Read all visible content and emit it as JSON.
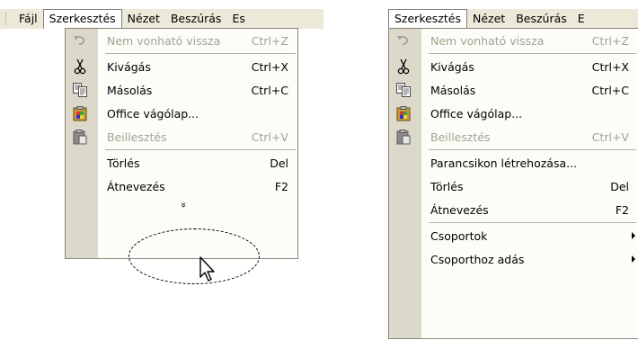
{
  "left": {
    "menubar": [
      "Fájl",
      "Szerkesztés",
      "Nézet",
      "Beszúrás",
      "Es"
    ],
    "open_index": 1,
    "items": [
      {
        "type": "item",
        "icon": "undo-icon",
        "label": "Nem vonható vissza",
        "shortcut": "Ctrl+Z",
        "disabled": true
      },
      {
        "type": "sep"
      },
      {
        "type": "item",
        "icon": "scissors-icon",
        "label": "Kivágás",
        "shortcut": "Ctrl+X",
        "disabled": false
      },
      {
        "type": "item",
        "icon": "copy-icon",
        "label": "Másolás",
        "shortcut": "Ctrl+C",
        "disabled": false
      },
      {
        "type": "item",
        "icon": "clipboard-office-icon",
        "label": "Office vágólap...",
        "shortcut": "",
        "disabled": false
      },
      {
        "type": "item",
        "icon": "paste-icon",
        "label": "Beillesztés",
        "shortcut": "Ctrl+V",
        "disabled": true
      },
      {
        "type": "sep"
      },
      {
        "type": "item",
        "icon": "",
        "label": "Törlés",
        "shortcut": "Del",
        "disabled": false
      },
      {
        "type": "item",
        "icon": "",
        "label": "Átnevezés",
        "shortcut": "F2",
        "disabled": false
      },
      {
        "type": "expand",
        "label": "»"
      }
    ]
  },
  "right": {
    "menubar": [
      "Szerkesztés",
      "Nézet",
      "Beszúrás",
      "E"
    ],
    "open_index": 0,
    "items": [
      {
        "type": "item",
        "icon": "undo-icon",
        "label": "Nem vonható vissza",
        "shortcut": "Ctrl+Z",
        "disabled": true
      },
      {
        "type": "sep"
      },
      {
        "type": "item",
        "icon": "scissors-icon",
        "label": "Kivágás",
        "shortcut": "Ctrl+X",
        "disabled": false
      },
      {
        "type": "item",
        "icon": "copy-icon",
        "label": "Másolás",
        "shortcut": "Ctrl+C",
        "disabled": false
      },
      {
        "type": "item",
        "icon": "clipboard-office-icon",
        "label": "Office vágólap...",
        "shortcut": "",
        "disabled": false
      },
      {
        "type": "item",
        "icon": "paste-icon",
        "label": "Beillesztés",
        "shortcut": "Ctrl+V",
        "disabled": true
      },
      {
        "type": "sep"
      },
      {
        "type": "item",
        "icon": "",
        "label": "Parancsikon létrehozása...",
        "shortcut": "",
        "disabled": false
      },
      {
        "type": "item",
        "icon": "",
        "label": "Törlés",
        "shortcut": "Del",
        "disabled": false
      },
      {
        "type": "item",
        "icon": "",
        "label": "Átnevezés",
        "shortcut": "F2",
        "disabled": false
      },
      {
        "type": "sep"
      },
      {
        "type": "item",
        "icon": "",
        "label": "Csoportok",
        "shortcut": "",
        "disabled": false,
        "submenu": true
      },
      {
        "type": "item",
        "icon": "",
        "label": "Csoporthoz adás",
        "shortcut": "",
        "disabled": false,
        "submenu": true
      }
    ]
  }
}
